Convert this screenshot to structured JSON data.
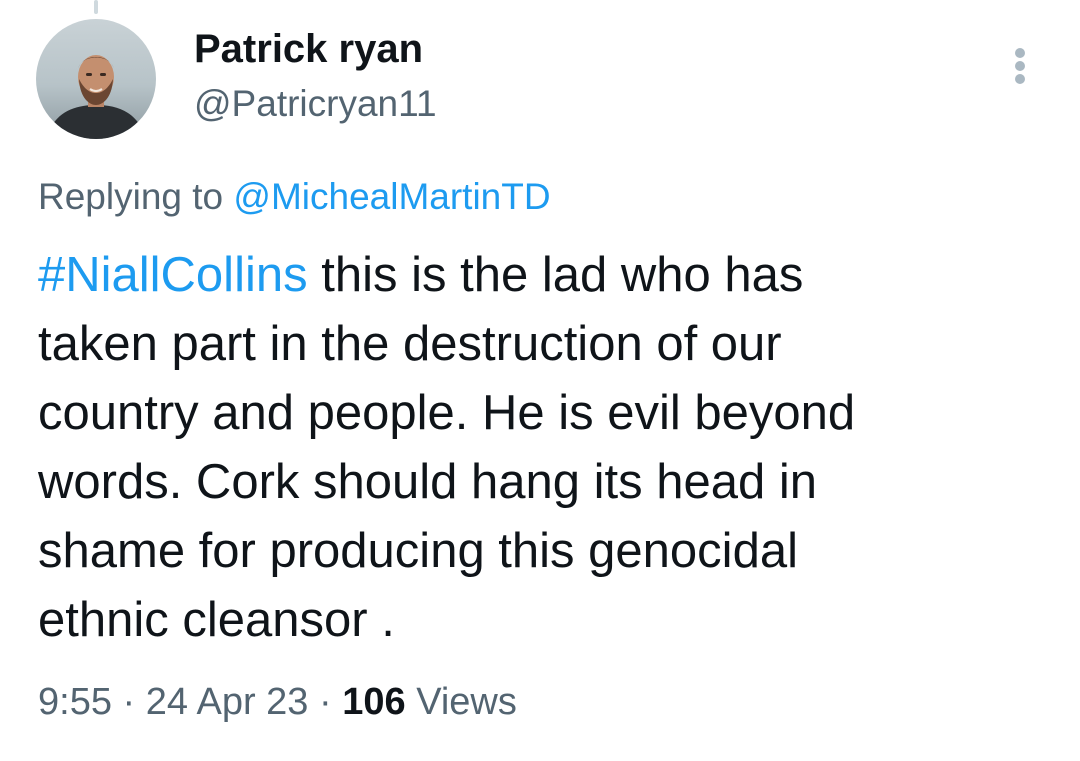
{
  "author": {
    "display_name": "Patrick ryan",
    "handle": "@Patricryan11"
  },
  "reply": {
    "prefix": "Replying to",
    "mention": "@MichealMartinTD"
  },
  "tweet": {
    "hashtag": "#NiallCollins",
    "first_line_rest": "this is the lad who has",
    "lines": [
      "taken part in the destruction of our",
      "country and people. He is evil beyond",
      "words. Cork should hang its head in",
      "shame for producing this genocidal",
      "ethnic cleansor ."
    ]
  },
  "meta": {
    "time": "9:55",
    "date": "24 Apr 23",
    "separator": "·",
    "views_count": "106",
    "views_label": "Views"
  },
  "icons": {
    "more": "more-vertical-icon"
  },
  "colors": {
    "link": "#1d9bf0",
    "text": "#0f1419",
    "secondary": "#536471"
  }
}
